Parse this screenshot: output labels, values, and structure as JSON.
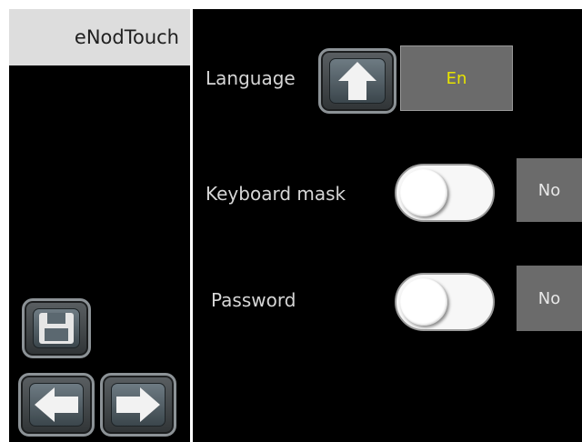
{
  "app": {
    "title": "eNodTouch"
  },
  "settings": {
    "language": {
      "label": "Language",
      "value": "En"
    },
    "keyboard_mask": {
      "label": "Keyboard mask",
      "state": "No"
    },
    "password": {
      "label": "Password",
      "state": "No"
    }
  },
  "icons": {
    "language_button": "arrow-up-icon",
    "save_button": "floppy-disk-icon",
    "back_button": "arrow-left-icon",
    "forward_button": "arrow-right-icon"
  },
  "colors": {
    "language_value_text": "#e8e400",
    "panel_background": "#000000",
    "title_background": "#dddddd",
    "value_box": "#6b6b6b"
  }
}
